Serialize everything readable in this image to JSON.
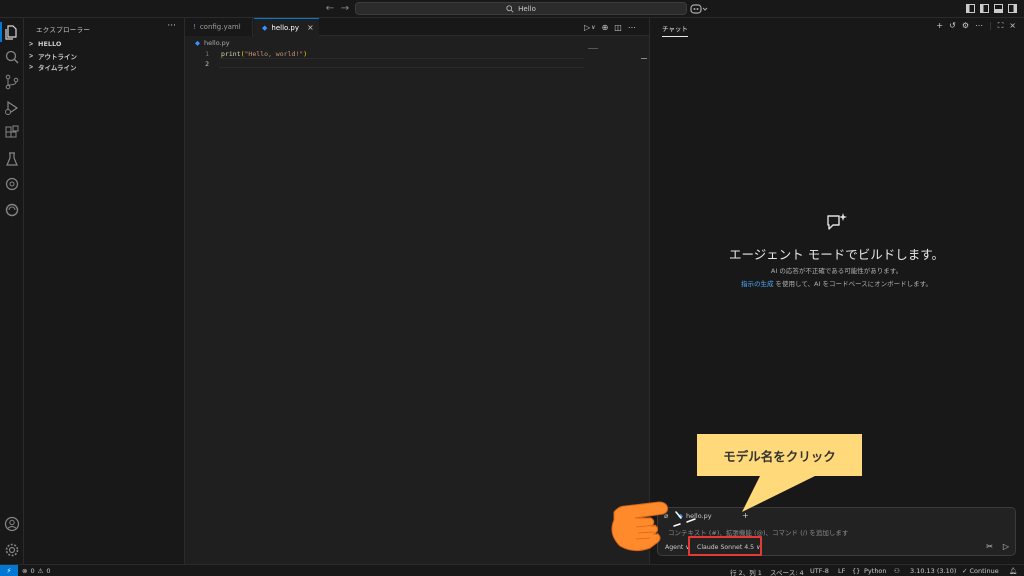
{
  "titlebar": {
    "search_text": "Hello",
    "nav_back": "←",
    "nav_forward": "→"
  },
  "sidebar": {
    "title": "エクスプローラー",
    "more": "···",
    "sections": [
      {
        "label": "HELLO"
      },
      {
        "label": "アウトライン"
      },
      {
        "label": "タイムライン"
      }
    ]
  },
  "tabs": [
    {
      "label": "config.yaml",
      "icon": "!"
    },
    {
      "label": "hello.py",
      "icon": "◆",
      "close": "×"
    }
  ],
  "breadcrumb": {
    "file": "hello.py",
    "icon": "◆"
  },
  "editor": {
    "line_numbers": [
      "1",
      "2"
    ],
    "code": {
      "fn": "print",
      "open": "(",
      "str": "\"Hello, world!\"",
      "close": ")"
    },
    "minimap_label": "ーーー"
  },
  "chat": {
    "tab_label": "チャット",
    "heading": "エージェント モードでビルドします。",
    "disclaimer": "AI の応答が不正確である可能性があります。",
    "instructions_link": "指示の生成",
    "instructions_rest": " を使用して、AI をコードベースにオンボードします。",
    "input": {
      "context_file": "hello.py",
      "placeholder": "コンテキスト (#)、拡張機能 (@)、コマンド (/) を追加します",
      "mode": "Agent ∨",
      "model": "Claude Sonnet 4.5 ∨"
    }
  },
  "annotation": {
    "callout_text": "モデル名をクリック",
    "colors": {
      "callout": "#ffd97a",
      "highlight": "#e53935",
      "hand": "#ff8a2b"
    }
  },
  "statusbar": {
    "remote_icon": "⚡",
    "errors": "0",
    "warnings": "0",
    "position": "行 2、列 1",
    "spaces": "スペース: 4",
    "encoding": "UTF-8",
    "eol": "LF",
    "language": "Python",
    "python_version": "3.10.13 (3.10)",
    "continue": "✓ Continue"
  },
  "colors": {
    "accent": "#0078d4",
    "background": "#1f1f1f",
    "sidebar": "#181818"
  }
}
